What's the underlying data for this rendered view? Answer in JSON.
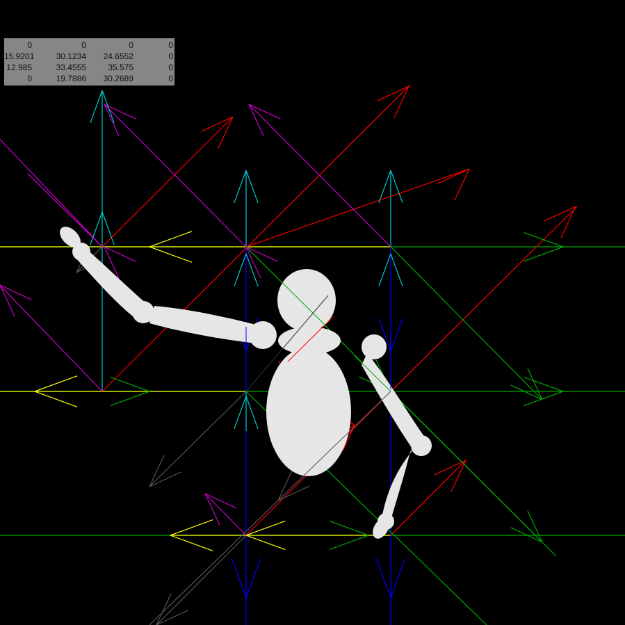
{
  "viewport": {
    "background": "#000000"
  },
  "matrix_panel": {
    "rows": [
      [
        "0",
        "0",
        "0",
        "0"
      ],
      [
        "15.9201",
        "30.1234",
        "24.6552",
        "0"
      ],
      [
        "12.985",
        "33.4555",
        "35.575",
        "0"
      ],
      [
        "0",
        "19.7886",
        "30.2689",
        "0"
      ]
    ]
  },
  "field": {
    "colors": {
      "x_axis": "#ffff00",
      "x_axis_pos": "#00aa00",
      "y_axis_up": "#00cccc",
      "y_axis_down": "#0000ff",
      "diag_red": "#ff0000",
      "diag_magenta": "#cc00cc",
      "diag_green": "#00aa00",
      "diag_gray": "#555555"
    }
  },
  "figure": {
    "fill": "#e6e6e6"
  }
}
